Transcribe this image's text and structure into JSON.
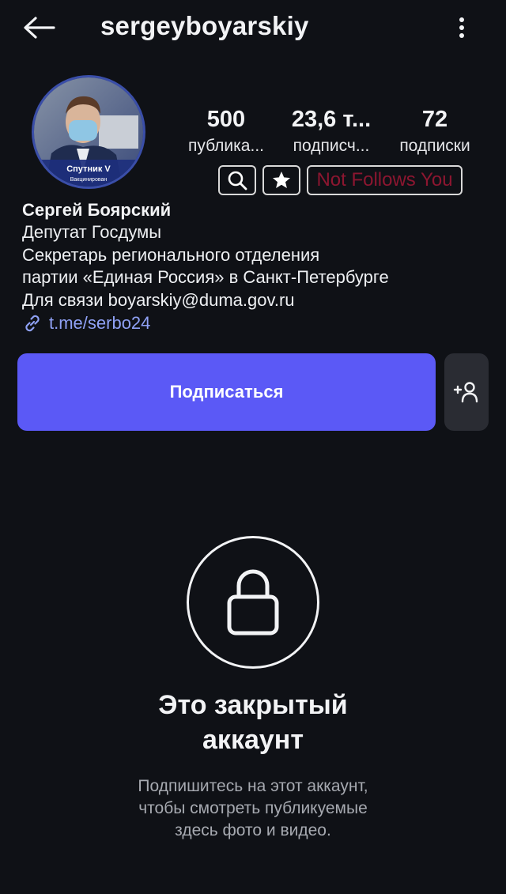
{
  "header": {
    "username": "sergeyboyarskiy",
    "back_icon": "arrow-left-icon",
    "more_icon": "more-vertical-icon"
  },
  "profile": {
    "avatar_badge_line1": "Спутник V",
    "avatar_badge_line2": "Вакцинирован",
    "stats": [
      {
        "value": "500",
        "label": "публика..."
      },
      {
        "value": "23,6 т...",
        "label": "подписч..."
      },
      {
        "value": "72",
        "label": "подписки"
      }
    ],
    "tools": {
      "search_icon": "search-icon",
      "star_icon": "star-icon",
      "not_follows_label": "Not Follows You",
      "not_follows_color": "#8c1630"
    },
    "name": "Сергей Боярский",
    "bio_lines": [
      "Депутат Госдумы",
      "Секретарь регионального отделения",
      "партии «Единая Россия» в Санкт-Петербурге",
      "Для связи boyarskiy@duma.gov.ru"
    ],
    "link": "t.me/serbo24"
  },
  "actions": {
    "follow_label": "Подписаться",
    "follow_color": "#5b59f6",
    "suggest_icon": "add-person-icon"
  },
  "private": {
    "title_line1": "Это закрытый",
    "title_line2": "аккаунт",
    "desc_lines": [
      "Подпишитесь на этот аккаунт,",
      "чтобы смотреть публикуемые",
      "здесь фото и видео."
    ]
  }
}
